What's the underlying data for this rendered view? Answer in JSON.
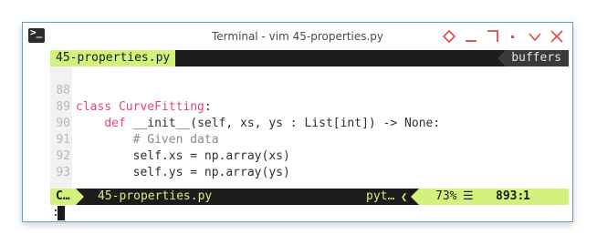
{
  "window": {
    "title": "Terminal - vim 45-properties.py",
    "app_icon_text": ">_",
    "controls": [
      "diamond-icon",
      "minimize-icon",
      "maximize-icon",
      "dot-icon",
      "chevron-down-icon",
      "close-icon"
    ]
  },
  "tabline": {
    "active_buffer": "45-properties.py",
    "right_label": "buffers"
  },
  "code": {
    "lines": [
      {
        "num": "88",
        "text": "class CurveFitting:"
      },
      {
        "num": "89",
        "text": "    def __init__(self, xs, ys : List[int]) -> None:"
      },
      {
        "num": "90",
        "text": "        # Given data"
      },
      {
        "num": "91",
        "text": "        self.xs = np.array(xs)"
      },
      {
        "num": "92",
        "text": "        self.ys = np.array(ys)"
      },
      {
        "num": "93",
        "text": ""
      }
    ]
  },
  "statusline": {
    "mode": "C…",
    "file": "45-properties.py",
    "filetype": "pyt…",
    "percent": "73%",
    "lines_icon": "☰",
    "line": "893:",
    "col": "1"
  },
  "cmdline": {
    "text": ":"
  },
  "colors": {
    "accent": "#d2f27d",
    "background": "#1c1c1c",
    "keyword": "#e0457b",
    "classname": "#6c9dd3",
    "comment": "#8a8a8a"
  }
}
